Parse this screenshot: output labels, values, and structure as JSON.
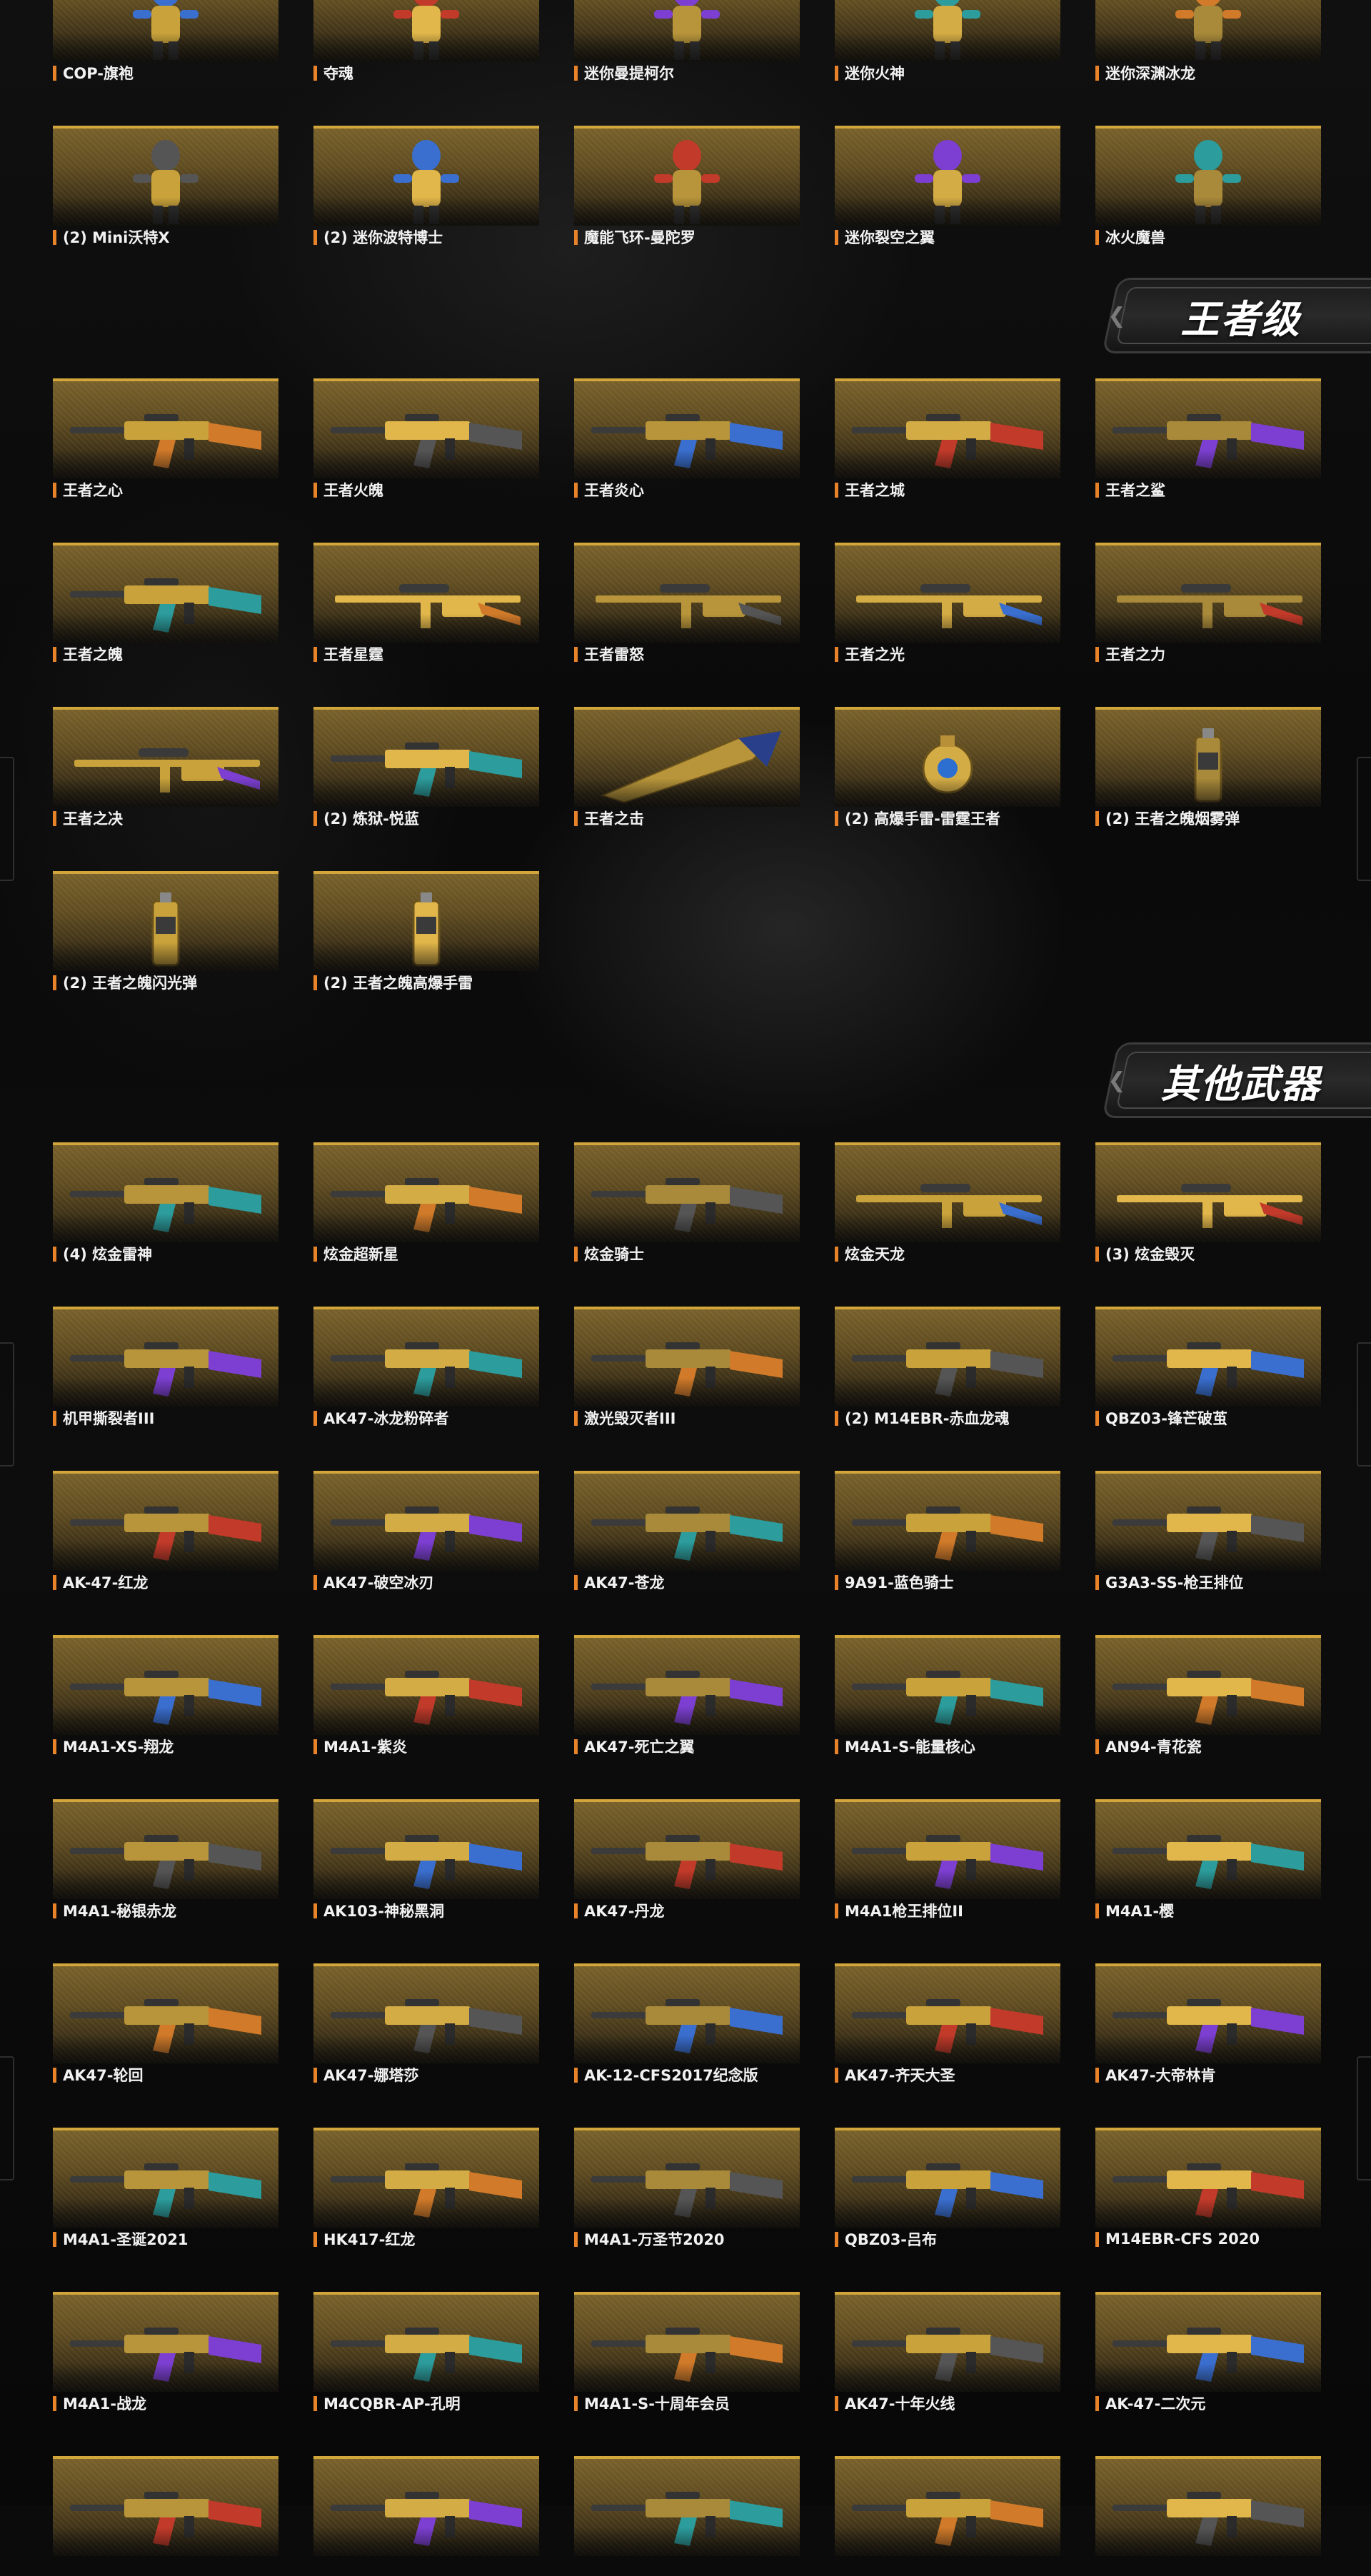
{
  "colors": {
    "accent": "#e8832a",
    "frame": "#d2a63a",
    "card_bg": "#5f4c22",
    "page_bg": "#0b0b0b"
  },
  "sections": [
    {
      "title": null,
      "items": [
        {
          "label": "COP-旗袍",
          "icon": "character-icon"
        },
        {
          "label": "夺魂",
          "icon": "character-icon"
        },
        {
          "label": "迷你曼提柯尔",
          "icon": "character-icon"
        },
        {
          "label": "迷你火神",
          "icon": "character-icon"
        },
        {
          "label": "迷你深渊冰龙",
          "icon": "character-icon"
        },
        {
          "label": "(2) Mini沃特X",
          "icon": "character-icon"
        },
        {
          "label": "(2) 迷你波特博士",
          "icon": "character-icon"
        },
        {
          "label": "魔能飞环-曼陀罗",
          "icon": "character-icon"
        },
        {
          "label": "迷你裂空之翼",
          "icon": "character-icon"
        },
        {
          "label": "冰火魔兽",
          "icon": "character-icon"
        }
      ]
    },
    {
      "title": "王者级",
      "items": [
        {
          "label": "王者之心",
          "icon": "rifle-icon"
        },
        {
          "label": "王者火魄",
          "icon": "rifle-icon"
        },
        {
          "label": "王者炎心",
          "icon": "rifle-icon"
        },
        {
          "label": "王者之城",
          "icon": "rifle-icon"
        },
        {
          "label": "王者之鲨",
          "icon": "rifle-icon"
        },
        {
          "label": "王者之魄",
          "icon": "rifle-icon"
        },
        {
          "label": "王者星霆",
          "icon": "sniper-icon"
        },
        {
          "label": "王者雷怒",
          "icon": "sniper-icon"
        },
        {
          "label": "王者之光",
          "icon": "sniper-icon"
        },
        {
          "label": "王者之力",
          "icon": "sniper-icon"
        },
        {
          "label": "王者之决",
          "icon": "sniper-icon"
        },
        {
          "label": "(2) 炼狱-悦蓝",
          "icon": "rifle-icon"
        },
        {
          "label": "王者之击",
          "icon": "axe-icon"
        },
        {
          "label": "(2) 高爆手雷-雷霆王者",
          "icon": "grenade-icon"
        },
        {
          "label": "(2) 王者之魄烟雾弹",
          "icon": "canister-icon"
        },
        {
          "label": "(2) 王者之魄闪光弹",
          "icon": "canister-icon"
        },
        {
          "label": "(2) 王者之魄高爆手雷",
          "icon": "canister-icon"
        }
      ]
    },
    {
      "title": "其他武器",
      "items": [
        {
          "label": "(4) 炫金雷神",
          "icon": "rifle-icon"
        },
        {
          "label": "炫金超新星",
          "icon": "rifle-icon"
        },
        {
          "label": "炫金骑士",
          "icon": "rifle-icon"
        },
        {
          "label": "炫金天龙",
          "icon": "sniper-icon"
        },
        {
          "label": "(3) 炫金毁灭",
          "icon": "sniper-icon"
        },
        {
          "label": "机甲撕裂者III",
          "icon": "rifle-icon"
        },
        {
          "label": "AK47-冰龙粉碎者",
          "icon": "rifle-icon"
        },
        {
          "label": "激光毁灭者III",
          "icon": "rifle-icon"
        },
        {
          "label": "(2) M14EBR-赤血龙魂",
          "icon": "rifle-icon"
        },
        {
          "label": "QBZ03-锋芒破茧",
          "icon": "rifle-icon"
        },
        {
          "label": "AK-47-红龙",
          "icon": "rifle-icon"
        },
        {
          "label": "AK47-破空冰刃",
          "icon": "rifle-icon"
        },
        {
          "label": "AK47-苍龙",
          "icon": "rifle-icon"
        },
        {
          "label": "9A91-蓝色骑士",
          "icon": "rifle-icon"
        },
        {
          "label": "G3A3-SS-枪王排位",
          "icon": "rifle-icon"
        },
        {
          "label": "M4A1-XS-翔龙",
          "icon": "rifle-icon"
        },
        {
          "label": "M4A1-紫炎",
          "icon": "rifle-icon"
        },
        {
          "label": "AK47-死亡之翼",
          "icon": "rifle-icon"
        },
        {
          "label": "M4A1-S-能量核心",
          "icon": "rifle-icon"
        },
        {
          "label": "AN94-青花瓷",
          "icon": "rifle-icon"
        },
        {
          "label": "M4A1-秘银赤龙",
          "icon": "rifle-icon"
        },
        {
          "label": "AK103-神秘黑洞",
          "icon": "rifle-icon"
        },
        {
          "label": "AK47-丹龙",
          "icon": "rifle-icon"
        },
        {
          "label": "M4A1枪王排位II",
          "icon": "rifle-icon"
        },
        {
          "label": "M4A1-樱",
          "icon": "rifle-icon"
        },
        {
          "label": "AK47-轮回",
          "icon": "rifle-icon"
        },
        {
          "label": "AK47-娜塔莎",
          "icon": "rifle-icon"
        },
        {
          "label": "AK-12-CFS2017纪念版",
          "icon": "rifle-icon"
        },
        {
          "label": "AK47-齐天大圣",
          "icon": "rifle-icon"
        },
        {
          "label": "AK47-大帝林肯",
          "icon": "rifle-icon"
        },
        {
          "label": "M4A1-圣诞2021",
          "icon": "rifle-icon"
        },
        {
          "label": "HK417-红龙",
          "icon": "rifle-icon"
        },
        {
          "label": "M4A1-万圣节2020",
          "icon": "rifle-icon"
        },
        {
          "label": "QBZ03-吕布",
          "icon": "rifle-icon"
        },
        {
          "label": "M14EBR-CFS 2020",
          "icon": "rifle-icon"
        },
        {
          "label": "M4A1-战龙",
          "icon": "rifle-icon"
        },
        {
          "label": "M4CQBR-AP-孔明",
          "icon": "rifle-icon"
        },
        {
          "label": "M4A1-S-十周年会员",
          "icon": "rifle-icon"
        },
        {
          "label": "AK47-十年火线",
          "icon": "rifle-icon"
        },
        {
          "label": "AK-47-二次元",
          "icon": "rifle-icon"
        },
        {
          "label": "",
          "icon": "rifle-icon"
        },
        {
          "label": "",
          "icon": "rifle-icon"
        },
        {
          "label": "",
          "icon": "rifle-icon"
        },
        {
          "label": "",
          "icon": "rifle-icon"
        },
        {
          "label": "",
          "icon": "rifle-icon"
        }
      ]
    }
  ]
}
